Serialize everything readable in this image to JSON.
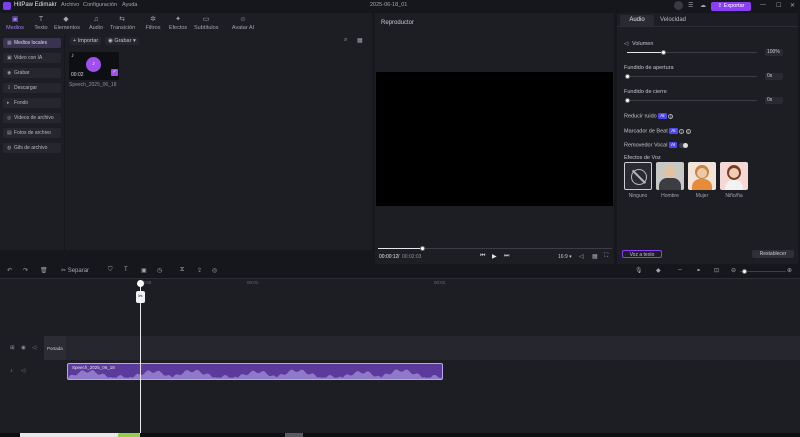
{
  "app": {
    "title": "HitPaw Edimakr",
    "menu": [
      "Archivo",
      "Configuración",
      "Ayuda"
    ],
    "project": "2025-06-18_01",
    "export_label": "Exportar",
    "window": {
      "min": "—",
      "max": "☐",
      "close": "✕"
    }
  },
  "toolbar": [
    {
      "label": "Medios",
      "icon": "media-icon",
      "glyph": "▣",
      "active": true
    },
    {
      "label": "Texto",
      "icon": "text-icon",
      "glyph": "T"
    },
    {
      "label": "Elementos",
      "icon": "elements-icon",
      "glyph": "◆"
    },
    {
      "label": "Audio",
      "icon": "audio-icon",
      "glyph": "♫"
    },
    {
      "label": "Transición",
      "icon": "transition-icon",
      "glyph": "⇆"
    },
    {
      "label": "Filtros",
      "icon": "filters-icon",
      "glyph": "✲"
    },
    {
      "label": "Efectos",
      "icon": "effects-icon",
      "glyph": "✦"
    },
    {
      "label": "Subtítulos",
      "icon": "subtitles-icon",
      "glyph": "▭"
    },
    {
      "label": "Avatar AI",
      "icon": "avatar-ai-icon",
      "glyph": "☺"
    }
  ],
  "sidebar": [
    {
      "label": "Medios locales",
      "icon": "folder-icon",
      "glyph": "▦",
      "active": true
    },
    {
      "label": "Video con IA",
      "icon": "ai-video-icon",
      "glyph": "▣"
    },
    {
      "label": "Grabar",
      "icon": "record-icon",
      "glyph": "◉"
    },
    {
      "label": "Descargar",
      "icon": "download-icon",
      "glyph": "⇩"
    },
    {
      "label": "Fondo",
      "icon": "background-icon",
      "glyph": "▸"
    },
    {
      "label": "Videos de archivo",
      "icon": "stock-video-icon",
      "glyph": "◎"
    },
    {
      "label": "Fotos de archivo",
      "icon": "stock-photo-icon",
      "glyph": "▤"
    },
    {
      "label": "Gifs de archivo",
      "icon": "gif-icon",
      "glyph": "◍"
    }
  ],
  "media": {
    "import_label": "+ Importar",
    "record_label": "◉ Grabar ▾",
    "item": {
      "duration": "00:02",
      "name": "Speech_2025_06_18"
    }
  },
  "player": {
    "title": "Reproductor",
    "current": "00:00:12",
    "total": "00:02:03",
    "ratio": "16:9 ▾",
    "progress": 0.19
  },
  "right": {
    "tabs": [
      {
        "label": "Audio",
        "active": true
      },
      {
        "label": "Velocidad"
      }
    ],
    "volume": {
      "label": "Volumen",
      "value": "100%",
      "level": 0.28
    },
    "fade_in": {
      "label": "Fundido de apertura",
      "value": "0s",
      "level": 0
    },
    "fade_out": {
      "label": "Fundido de cierre",
      "value": "0s",
      "level": 0
    },
    "noise": {
      "label": "Reducir ruido",
      "ai": "AI"
    },
    "beat": {
      "label": "Marcador de Beat",
      "ai": "AI"
    },
    "vocal": {
      "label": "Removedor Vocal",
      "ai": "AI"
    },
    "voice_effects": {
      "label": "Efectos de Voz",
      "items": [
        {
          "name": "Ninguno",
          "selected": true
        },
        {
          "name": "Hombre"
        },
        {
          "name": "Mujer"
        },
        {
          "name": "Niño/ña"
        }
      ]
    },
    "voice_to_text": "Voz a texto",
    "reset": "Restablecer"
  },
  "timeline": {
    "split_label": "Separar",
    "ticks": [
      "00:00",
      "00:01",
      "00:02"
    ],
    "cover_label": "Portada",
    "audio_clip_name": "Speech_2025_06_18"
  },
  "colors": {
    "accent": "#8a3ff5",
    "audio_clip": "#5c3a9c",
    "panel": "#1d1e24",
    "background": "#16171c"
  }
}
